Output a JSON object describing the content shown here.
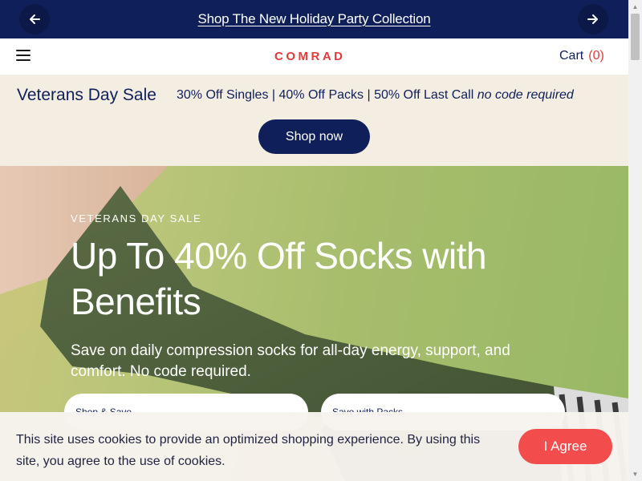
{
  "announcement": {
    "text": "Shop The New Holiday Party Collection",
    "prev_icon": "arrow-left-icon",
    "next_icon": "arrow-right-icon"
  },
  "header": {
    "logo": "COMRAD",
    "cart_label": "Cart",
    "cart_count": "(0)",
    "menu_icon": "hamburger-menu-icon"
  },
  "promo": {
    "title": "Veterans Day Sale",
    "detail": "30% Off Singles | 40% Off Packs | 50% Off Last Call",
    "note": "no code required",
    "button": "Shop now"
  },
  "hero": {
    "eyebrow": "VETERANS DAY SALE",
    "title": "Up To 40% Off Socks with Benefits",
    "subtitle": "Save on daily compression socks for all-day energy, support, and comfort. No code required.",
    "cta_primary": "Shop & Save",
    "cta_secondary": "Save with Packs",
    "cta_arrow": "→"
  },
  "cookie": {
    "text": "This site uses cookies to provide an optimized shopping experience. By using this site, you agree to the use of cookies.",
    "button": "I Agree"
  },
  "colors": {
    "navy": "#0f1f59",
    "accent_red": "#e23b3b",
    "agree_red": "#f24c4c",
    "promo_bg": "#f4ede2",
    "hero_green": "#a6bd6c"
  }
}
